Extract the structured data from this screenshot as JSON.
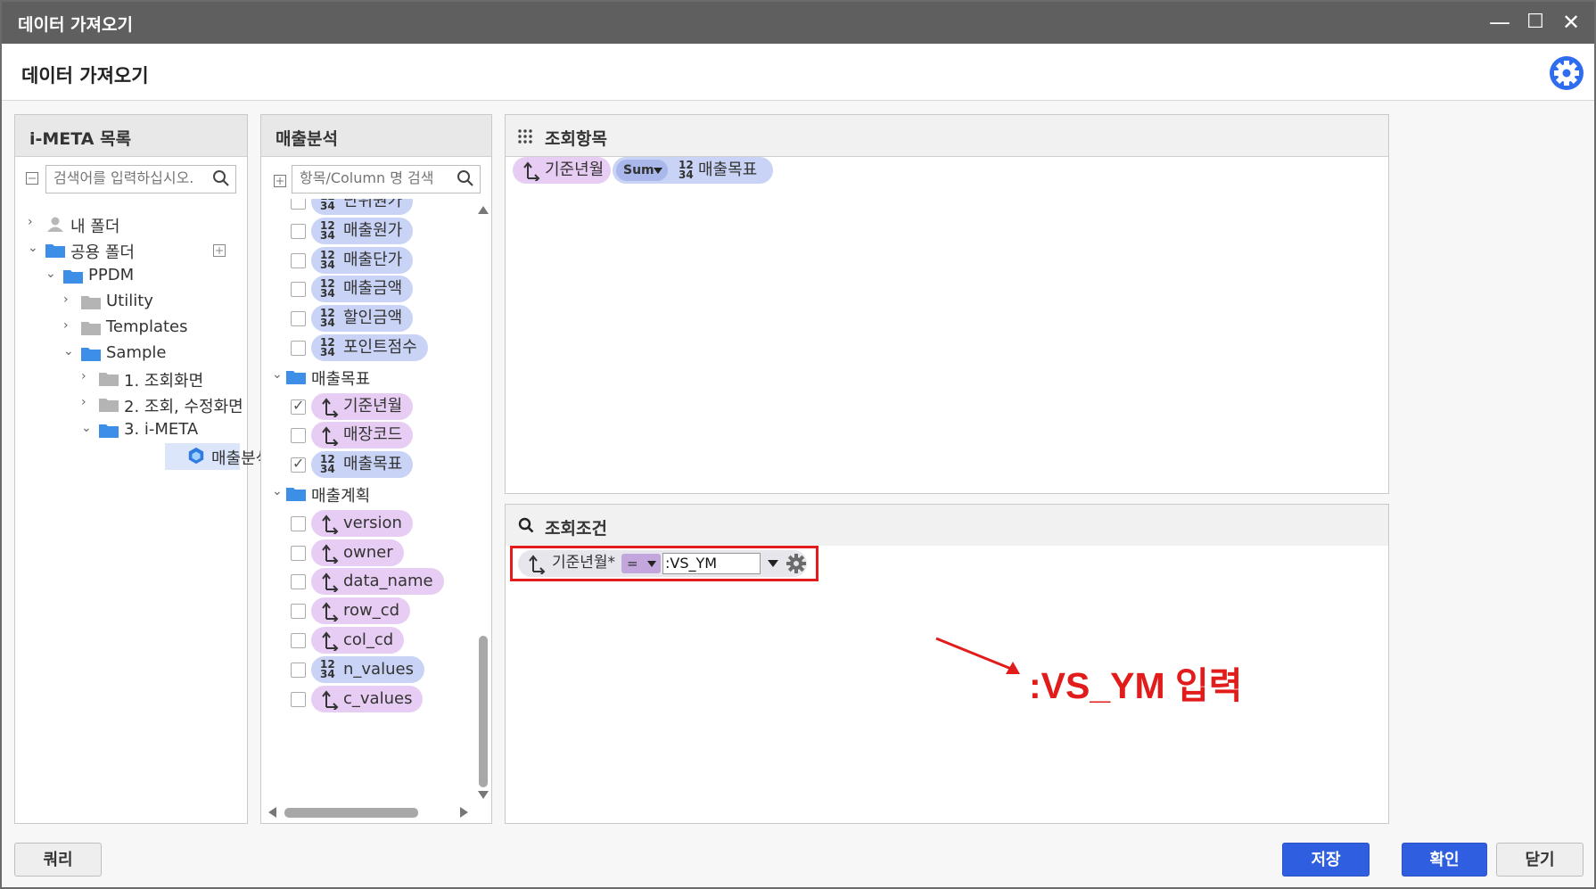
{
  "window": {
    "title": "데이터 가져오기",
    "minimize_glyph": "—",
    "maximize_glyph": "☐",
    "close_glyph": "✕"
  },
  "header": {
    "title": "데이터 가져오기",
    "settings_icon": "gear-icon"
  },
  "meta_panel": {
    "title": "i-META 목록",
    "search_placeholder": "검색어를 입력하십시오.",
    "tree": [
      {
        "label": "내 폴더",
        "type": "user"
      },
      {
        "label": "공용 폴더",
        "type": "folder"
      },
      {
        "label": "PPDM",
        "type": "folder"
      },
      {
        "label": "Utility",
        "type": "folder"
      },
      {
        "label": "Templates",
        "type": "folder"
      },
      {
        "label": "Sample",
        "type": "folder"
      },
      {
        "label": "1. 조회화면",
        "type": "folder"
      },
      {
        "label": "2. 조회, 수정화면",
        "type": "folder"
      },
      {
        "label": "3. i-META",
        "type": "folder"
      },
      {
        "label": "매출분석",
        "type": "cube",
        "selected": true
      }
    ]
  },
  "column_panel": {
    "title": "매출분석",
    "search_placeholder": "항목/Column 명 검색",
    "items": [
      {
        "label": "단위원가",
        "kind": "num",
        "checked": false
      },
      {
        "label": "매출원가",
        "kind": "num",
        "checked": false
      },
      {
        "label": "매출단가",
        "kind": "num",
        "checked": false
      },
      {
        "label": "매출금액",
        "kind": "num",
        "checked": false
      },
      {
        "label": "할인금액",
        "kind": "num",
        "checked": false
      },
      {
        "label": "포인트점수",
        "kind": "num",
        "checked": false
      },
      {
        "label": "매출목표",
        "kind": "group"
      },
      {
        "label": "기준년월",
        "kind": "dim",
        "checked": true
      },
      {
        "label": "매장코드",
        "kind": "dim",
        "checked": false
      },
      {
        "label": "매출목표",
        "kind": "num",
        "checked": true
      },
      {
        "label": "매출계획",
        "kind": "group"
      },
      {
        "label": "version",
        "kind": "dim",
        "checked": false
      },
      {
        "label": "owner",
        "kind": "dim",
        "checked": false
      },
      {
        "label": "data_name",
        "kind": "dim",
        "checked": false
      },
      {
        "label": "row_cd",
        "kind": "dim",
        "checked": false
      },
      {
        "label": "col_cd",
        "kind": "dim",
        "checked": false
      },
      {
        "label": "n_values",
        "kind": "num",
        "checked": false
      },
      {
        "label": "c_values",
        "kind": "dim",
        "checked": false
      }
    ]
  },
  "query_items": {
    "title": "조회항목",
    "dim_chip": "기준년월",
    "agg_label": "Sum",
    "num_chip": "매출목표"
  },
  "conditions": {
    "title": "조회조건",
    "field_label": "기준년월*",
    "operator": "=",
    "value": ":VS_YM"
  },
  "annotation": {
    "text": ":VS_YM 입력",
    "color": "#e21b1b"
  },
  "footer": {
    "query_button": "쿼리",
    "save_button": "저장",
    "ok_button": "확인",
    "close_button": "닫기"
  },
  "num_icon": {
    "top": "12",
    "bottom": "34"
  },
  "colors": {
    "accent": "#2f5fe0",
    "num_chip": "#c8d3f5",
    "dim_chip": "#e7cdf3",
    "highlight": "#e21b1b"
  }
}
